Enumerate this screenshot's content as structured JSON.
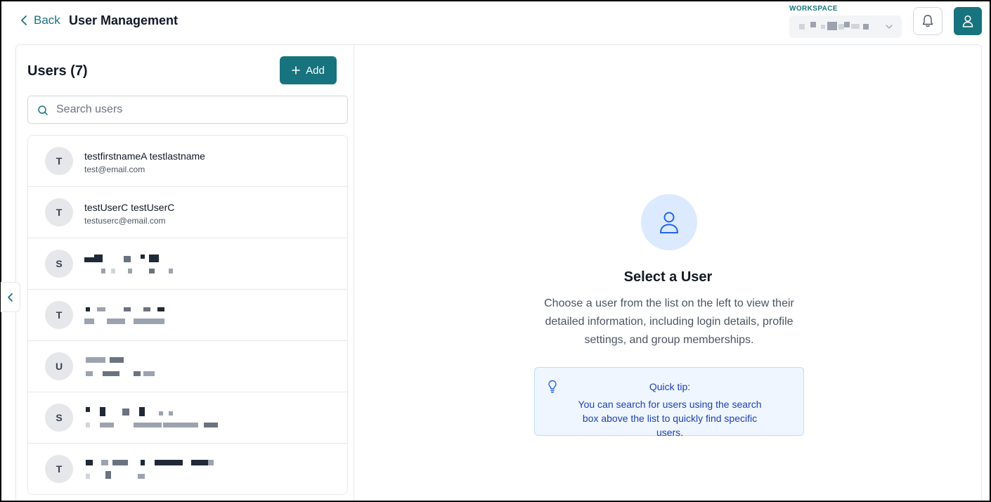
{
  "header": {
    "back_label": "Back",
    "title": "User Management",
    "workspace_label": "WORKSPACE",
    "workspace_value": ""
  },
  "users": {
    "title": "Users (7)",
    "add_label": "Add",
    "search_placeholder": "Search users",
    "items": [
      {
        "initial": "T",
        "name": "testfirstnameA testlastname",
        "email": "test@email.com"
      },
      {
        "initial": "T",
        "name": "testUserC testUserC",
        "email": "testuserc@email.com"
      },
      {
        "initial": "S",
        "name": "",
        "email": ""
      },
      {
        "initial": "T",
        "name": "",
        "email": ""
      },
      {
        "initial": "U",
        "name": "",
        "email": ""
      },
      {
        "initial": "S",
        "name": "",
        "email": ""
      },
      {
        "initial": "T",
        "name": "",
        "email": ""
      }
    ]
  },
  "empty_state": {
    "title": "Select a User",
    "description": "Choose a user from the list on the left to view their detailed information, including login details, profile settings, and group memberships.",
    "tip_title": "Quick tip:",
    "tip_text": "You can search for users using the search box above the list to quickly find specific users."
  },
  "colors": {
    "accent": "#17737d",
    "tip_bg": "#eff6ff",
    "tip_text": "#1e40af",
    "icon_circle": "#dbeafe"
  },
  "icons": [
    "chevron-left-icon",
    "chevron-down-icon",
    "bell-icon",
    "user-icon",
    "plus-icon",
    "search-icon",
    "lightbulb-icon"
  ]
}
